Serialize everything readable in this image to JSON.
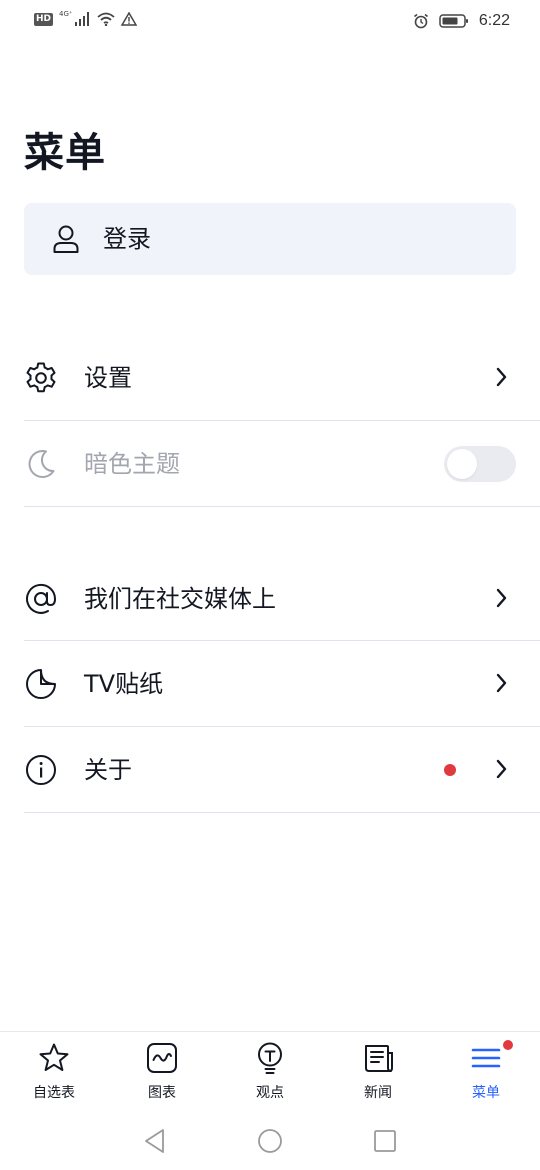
{
  "status_bar": {
    "network_badge": "HD",
    "network_type": "4G⁺",
    "time": "6:22",
    "icons": [
      "signal-icon",
      "wifi-icon",
      "warning-icon",
      "alarm-icon",
      "battery-icon"
    ]
  },
  "page": {
    "title": "菜单"
  },
  "login": {
    "label": "登录",
    "icon": "user-icon",
    "background": "#f0f3fa"
  },
  "menu": {
    "settings": {
      "label": "设置",
      "icon": "gear-icon"
    },
    "dark_theme": {
      "label": "暗色主题",
      "icon": "moon-icon",
      "toggle_on": false,
      "disabled": true
    },
    "social": {
      "label": "我们在社交媒体上",
      "icon": "at-icon"
    },
    "tv_stickers": {
      "label": "TV贴纸",
      "icon": "sticker-icon"
    },
    "about": {
      "label": "关于",
      "icon": "info-icon",
      "has_notification_dot": true
    }
  },
  "bottom_nav": {
    "items": [
      {
        "label": "自选表",
        "icon": "star-icon",
        "active": false
      },
      {
        "label": "图表",
        "icon": "chart-icon",
        "active": false
      },
      {
        "label": "观点",
        "icon": "lightbulb-icon",
        "active": false
      },
      {
        "label": "新闻",
        "icon": "newspaper-icon",
        "active": false
      },
      {
        "label": "菜单",
        "icon": "menu-icon",
        "active": true,
        "has_badge": true
      }
    ]
  },
  "colors": {
    "text_primary": "#131722",
    "text_disabled": "#a3a6af",
    "accent": "#2962ff",
    "notification": "#e03a3e",
    "divider": "#e0e3eb"
  }
}
